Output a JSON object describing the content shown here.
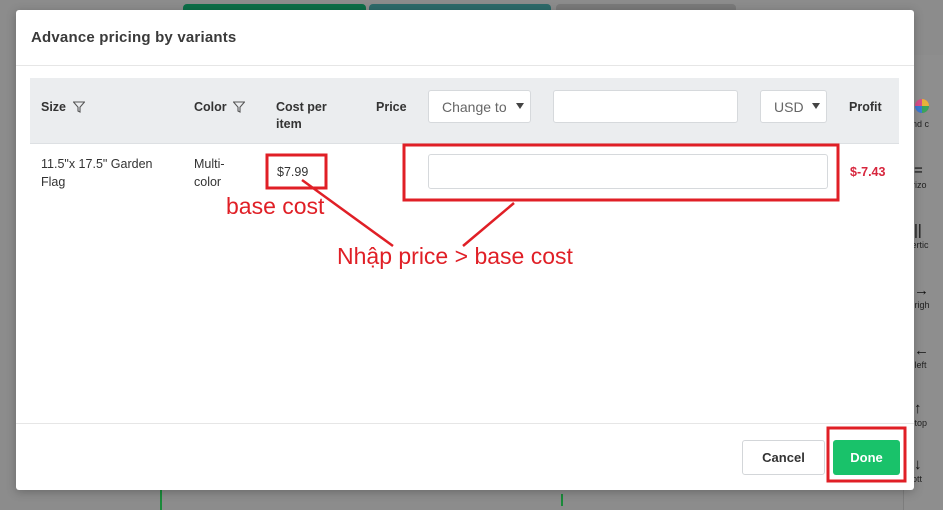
{
  "modal": {
    "title": "Advance pricing by variants"
  },
  "table": {
    "headers": {
      "size": "Size",
      "color": "Color",
      "cost_per_item_line1": "Cost per",
      "cost_per_item_line2": "item",
      "price": "Price",
      "profit": "Profit"
    },
    "bulk_controls": {
      "change_select": "Change to",
      "value_input": "",
      "currency_select": "USD"
    },
    "rows": [
      {
        "size_line1": "11.5\"x 17.5\" Garden",
        "size_line2": "Flag",
        "color_line1": "Multi-",
        "color_line2": "color",
        "cost": "$7.99",
        "price": "",
        "profit": "$-7.43"
      }
    ]
  },
  "footer": {
    "cancel_label": "Cancel",
    "done_label": "Done"
  },
  "annotations": {
    "base_cost_label": "base cost",
    "instruction": "Nhập price > base cost",
    "color": "#e01f26"
  },
  "background": {
    "side_items": [
      "und c",
      "orizo",
      "vertic",
      "n righ",
      "n left",
      "n top",
      "bott"
    ]
  }
}
